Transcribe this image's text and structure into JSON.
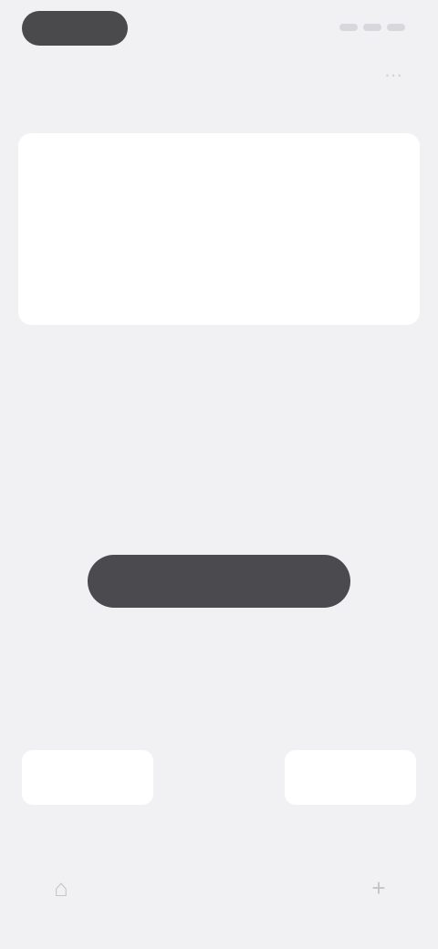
{
  "status_bar": {
    "time": ""
  },
  "header": {
    "title": ""
  },
  "top_card": {
    "label": "",
    "text": ""
  },
  "section": {
    "title": ""
  },
  "empty_state": {
    "title": "",
    "text": "",
    "button_label": ""
  },
  "segmented_control": {
    "left": "",
    "middle": "",
    "right": ""
  },
  "icons": {
    "header_action": "more-icon",
    "tab_left": "home-icon",
    "tab_right": "add-icon"
  },
  "colors": {
    "background": "#f1f1f4",
    "card": "#ffffff",
    "primary": "#4b4b4f"
  }
}
